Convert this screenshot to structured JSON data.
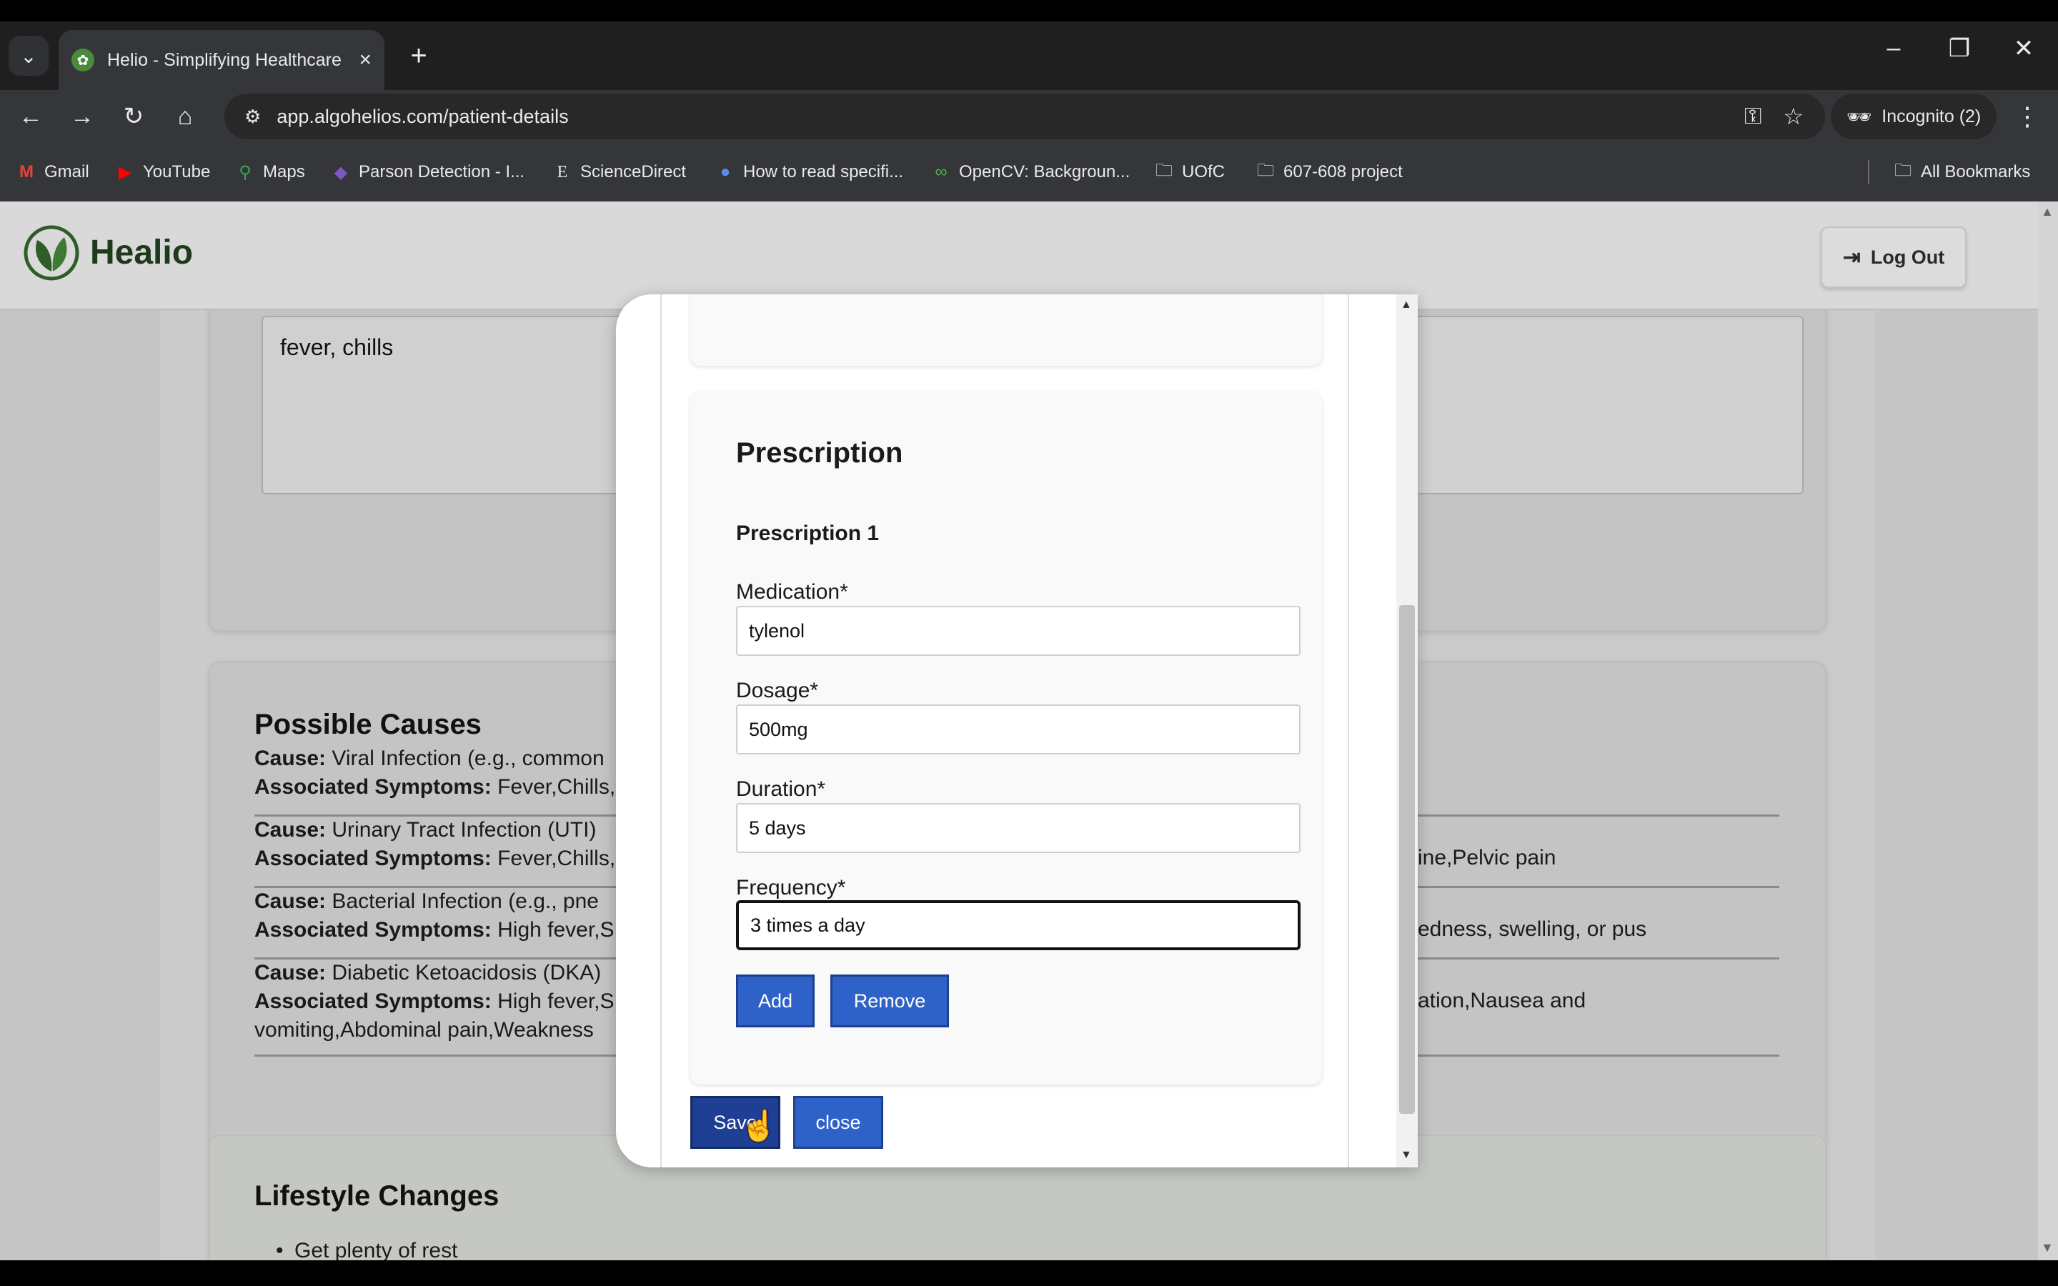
{
  "browser": {
    "tab_title": "Helio - Simplifying Healthcare",
    "url": "app.algohelios.com/patient-details",
    "incognito_label": "Incognito (2)",
    "bookmarks": [
      {
        "label": "Gmail",
        "icon": "gmail-icon"
      },
      {
        "label": "YouTube",
        "icon": "youtube-icon"
      },
      {
        "label": "Maps",
        "icon": "maps-icon"
      },
      {
        "label": "Parson Detection - I...",
        "icon": "bookmark-favicon"
      },
      {
        "label": "ScienceDirect",
        "icon": "sciencedirect-icon"
      },
      {
        "label": "How to read specifi...",
        "icon": "bookmark-favicon"
      },
      {
        "label": "OpenCV: Backgroun...",
        "icon": "opencv-icon"
      },
      {
        "label": "UOfC",
        "icon": "folder-icon"
      },
      {
        "label": "607-608 project",
        "icon": "folder-icon"
      }
    ],
    "all_bookmarks_label": "All Bookmarks"
  },
  "app": {
    "brand": "Healio",
    "logout_label": "Log Out"
  },
  "symptoms": {
    "value": "fever, chills"
  },
  "causes": {
    "title": "Possible Causes",
    "cause_label": "Cause:",
    "symptoms_label": "Associated Symptoms:",
    "items": [
      {
        "cause": "Viral Infection (e.g., common",
        "symptoms": "Fever,Chills,",
        "symptoms_tail": ""
      },
      {
        "cause": "Urinary Tract Infection (UTI)",
        "symptoms": "Fever,Chills,",
        "symptoms_tail": "ine,Pelvic pain"
      },
      {
        "cause": "Bacterial Infection (e.g., pne",
        "symptoms": "High fever,S",
        "symptoms_tail": "edness, swelling, or pus"
      },
      {
        "cause": "Diabetic Ketoacidosis (DKA)",
        "symptoms": "High fever,S",
        "symptoms_tail": "ation,Nausea and",
        "symptoms_line2": "vomiting,Abdominal pain,Weakness"
      }
    ]
  },
  "lifestyle": {
    "title": "Lifestyle Changes",
    "items": [
      "Get plenty of rest"
    ]
  },
  "prescription": {
    "title": "Prescription",
    "subtitle": "Prescription 1",
    "medication_label": "Medication*",
    "medication_value": "tylenol",
    "dosage_label": "Dosage*",
    "dosage_value": "500mg",
    "duration_label": "Duration*",
    "duration_value": "5 days",
    "frequency_label": "Frequency*",
    "frequency_value": "3 times a day",
    "add_label": "Add",
    "remove_label": "Remove",
    "save_label": "Save",
    "close_label": "close"
  },
  "colors": {
    "primary_button": "#2f62c8",
    "save_button": "#1f3f95",
    "brand_green": "#1d3a1c"
  }
}
